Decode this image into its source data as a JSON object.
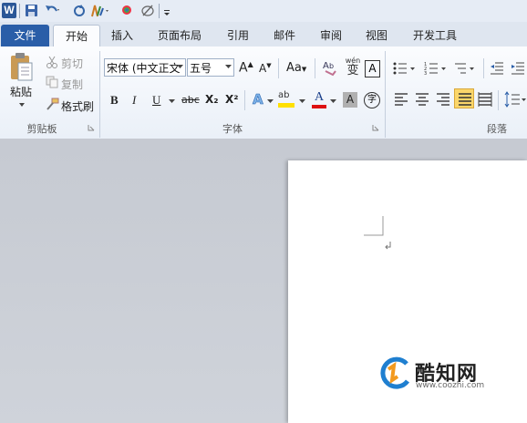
{
  "quick_access": {
    "app_icon": "word-icon",
    "items": [
      "save-icon",
      "undo-icon",
      "redo-icon",
      "format-painter-icon",
      "color-icon",
      "draw-icon",
      "customize-icon"
    ]
  },
  "tabs": [
    {
      "label": "文件",
      "active": false,
      "file": true
    },
    {
      "label": "开始",
      "active": true
    },
    {
      "label": "插入"
    },
    {
      "label": "页面布局"
    },
    {
      "label": "引用"
    },
    {
      "label": "邮件"
    },
    {
      "label": "审阅"
    },
    {
      "label": "视图"
    },
    {
      "label": "开发工具"
    }
  ],
  "clipboard": {
    "paste": "粘贴",
    "cut": "剪切",
    "copy": "复制",
    "format_painter": "格式刷",
    "group_label": "剪贴板"
  },
  "font": {
    "name": "宋体 (中文正文",
    "size": "五号",
    "group_label": "字体",
    "bold": "B",
    "italic": "I",
    "underline": "U",
    "strike": "abc",
    "subscript": "X₂",
    "superscript": "X²",
    "grow": "A",
    "shrink": "A",
    "case": "Aa",
    "wen": "wén",
    "wen_char": "变",
    "border_char": "A",
    "effect": "A",
    "highlight": "ab",
    "color": "A",
    "shade": "A",
    "enclose": "字"
  },
  "paragraph": {
    "group_label": "段落"
  },
  "watermark": {
    "brand": "酷知网",
    "url": "www.coozhi.com"
  },
  "colors": {
    "file_tab": "#2a5ea8",
    "accent_red": "#d11",
    "highlight_yellow": "#ffe000"
  }
}
